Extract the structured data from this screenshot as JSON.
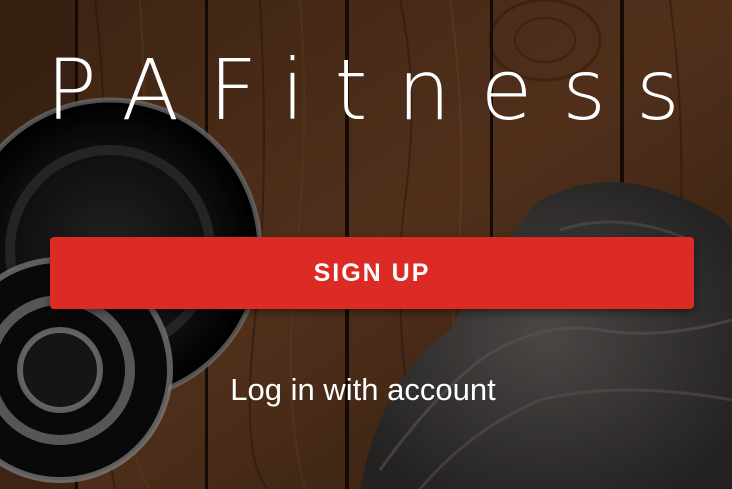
{
  "app": {
    "title": "PAFitness"
  },
  "actions": {
    "signup_label": "SIGN UP",
    "login_label": "Log in with account"
  },
  "colors": {
    "accent": "#dc2a24",
    "text": "#ffffff",
    "wood_dark": "#2e1a0e",
    "wood_mid": "#5a3720"
  }
}
